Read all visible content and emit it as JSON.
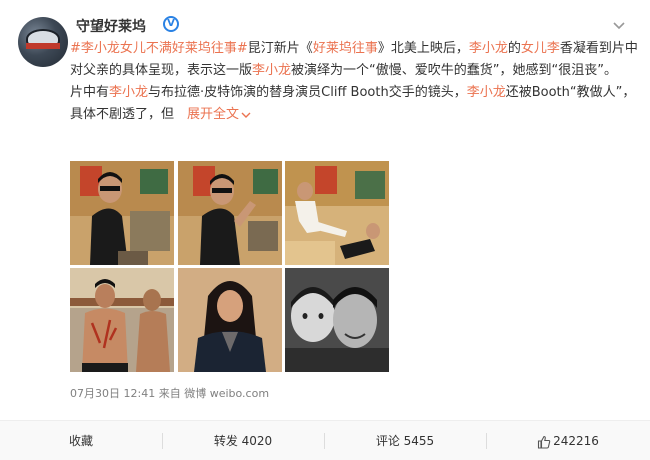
{
  "account": {
    "name": "守望好莱坞",
    "avatar_text": "HOLLYWOOD"
  },
  "post": {
    "hashtag": "#李小龙女儿不满好莱坞往事#",
    "line1_a": "昆汀新片《",
    "film_link": "好莱坞往事",
    "line1_b": "》北美上映后，",
    "name_a": "李小龙",
    "line1_c": "的",
    "name_b": "女儿李",
    "line1_d": "香凝看到片中对父亲的具体呈现，表示这一版",
    "name_c": "李小龙",
    "line1_e": "被演绎为一个“傲慢、爱吹牛的蠢货”，她感到“很沮丧”。",
    "line2_a": "片中有",
    "name_d": "李小龙",
    "line2_b": "与布拉德·皮特饰演的替身演员Cliff Booth交手的镜头，",
    "name_e": "李小龙",
    "line2_c": "还被Booth“教做人”，具体不剧透了，但",
    "expand": "展开全文"
  },
  "meta": {
    "date": "07月30日 12:41",
    "source_prefix": "来自",
    "source": "微博 weibo.com"
  },
  "actions": {
    "favorite": "收藏",
    "repost": "转发 4020",
    "comment": "评论 5455",
    "likes": "242216"
  },
  "icons": {
    "verified": "verified-badge-icon",
    "menu": "chevron-down-icon",
    "like": "thumbs-up-icon"
  },
  "colors": {
    "accent": "#eb7350",
    "verified": "#2a82e4"
  }
}
